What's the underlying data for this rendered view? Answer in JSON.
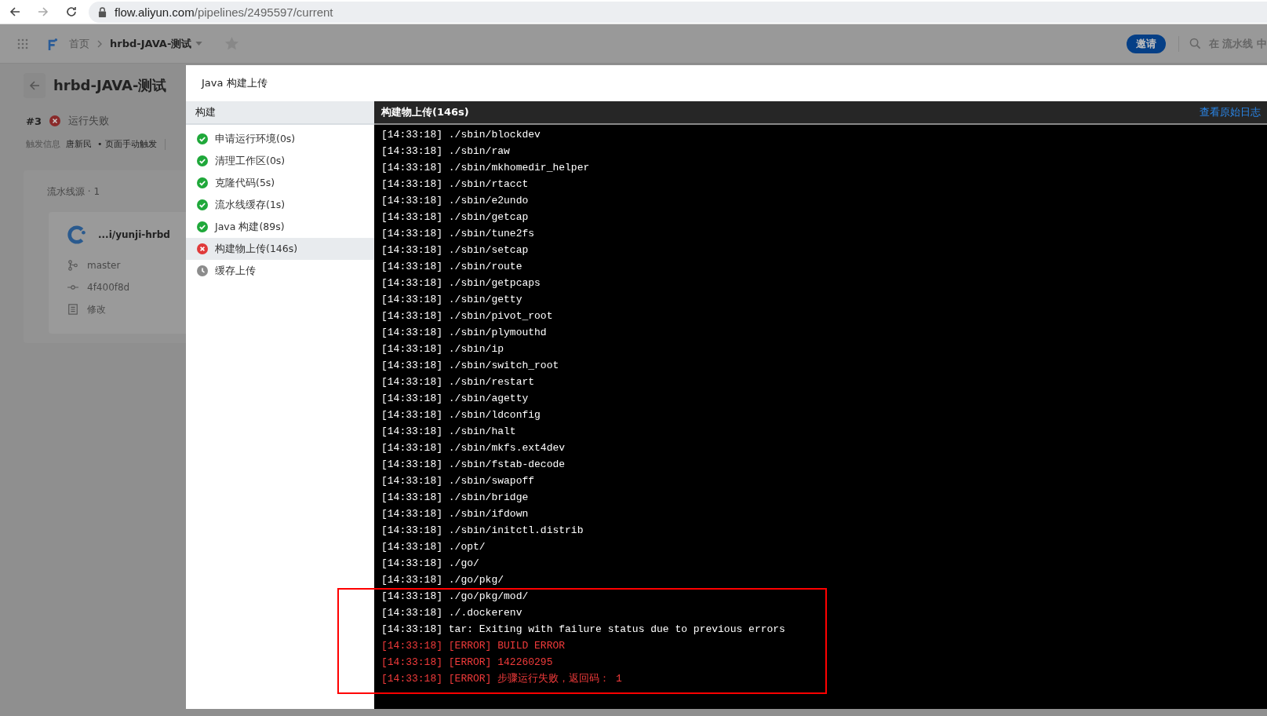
{
  "browser": {
    "url_host": "flow.aliyun.com",
    "url_path": "/pipelines/2495597/current"
  },
  "header": {
    "breadcrumb": [
      "首页",
      "hrbd-JAVA-测试"
    ],
    "invite_button": "邀请",
    "search_placeholder": "在 流水线 中"
  },
  "page": {
    "title": "hrbd-JAVA-测试",
    "run_number": "#3",
    "run_status": "运行失败",
    "trigger_label": "触发信息",
    "trigger_user": "唐新民",
    "trigger_mode": "• 页面手动触发",
    "sources_title": "流水线源 · 1",
    "source": {
      "repo": "...i/yunji-hrbd",
      "branch": "master",
      "commit": "4f400f8d",
      "message": "修改"
    }
  },
  "dialog": {
    "title": "Java 构建上传",
    "steps_header": "构建",
    "steps": [
      {
        "label": "申请运行环境(0s)",
        "kind": "success",
        "selected": false
      },
      {
        "label": "清理工作区(0s)",
        "kind": "success",
        "selected": false
      },
      {
        "label": "克隆代码(5s)",
        "kind": "success",
        "selected": false
      },
      {
        "label": "流水线缓存(1s)",
        "kind": "success",
        "selected": false
      },
      {
        "label": "Java 构建(89s)",
        "kind": "success",
        "selected": false
      },
      {
        "label": "构建物上传(146s)",
        "kind": "failed",
        "selected": true
      },
      {
        "label": "缓存上传",
        "kind": "pending",
        "selected": false
      }
    ],
    "log_title": "构建物上传(146s)",
    "raw_log_link": "查看原始日志",
    "log_lines": [
      {
        "text": "[14:33:18] ./sbin/blockdev",
        "kind": "info"
      },
      {
        "text": "[14:33:18] ./sbin/raw",
        "kind": "info"
      },
      {
        "text": "[14:33:18] ./sbin/mkhomedir_helper",
        "kind": "info"
      },
      {
        "text": "[14:33:18] ./sbin/rtacct",
        "kind": "info"
      },
      {
        "text": "[14:33:18] ./sbin/e2undo",
        "kind": "info"
      },
      {
        "text": "[14:33:18] ./sbin/getcap",
        "kind": "info"
      },
      {
        "text": "[14:33:18] ./sbin/tune2fs",
        "kind": "info"
      },
      {
        "text": "[14:33:18] ./sbin/setcap",
        "kind": "info"
      },
      {
        "text": "[14:33:18] ./sbin/route",
        "kind": "info"
      },
      {
        "text": "[14:33:18] ./sbin/getpcaps",
        "kind": "info"
      },
      {
        "text": "[14:33:18] ./sbin/getty",
        "kind": "info"
      },
      {
        "text": "[14:33:18] ./sbin/pivot_root",
        "kind": "info"
      },
      {
        "text": "[14:33:18] ./sbin/plymouthd",
        "kind": "info"
      },
      {
        "text": "[14:33:18] ./sbin/ip",
        "kind": "info"
      },
      {
        "text": "[14:33:18] ./sbin/switch_root",
        "kind": "info"
      },
      {
        "text": "[14:33:18] ./sbin/restart",
        "kind": "info"
      },
      {
        "text": "[14:33:18] ./sbin/agetty",
        "kind": "info"
      },
      {
        "text": "[14:33:18] ./sbin/ldconfig",
        "kind": "info"
      },
      {
        "text": "[14:33:18] ./sbin/halt",
        "kind": "info"
      },
      {
        "text": "[14:33:18] ./sbin/mkfs.ext4dev",
        "kind": "info"
      },
      {
        "text": "[14:33:18] ./sbin/fstab-decode",
        "kind": "info"
      },
      {
        "text": "[14:33:18] ./sbin/swapoff",
        "kind": "info"
      },
      {
        "text": "[14:33:18] ./sbin/bridge",
        "kind": "info"
      },
      {
        "text": "[14:33:18] ./sbin/ifdown",
        "kind": "info"
      },
      {
        "text": "[14:33:18] ./sbin/initctl.distrib",
        "kind": "info"
      },
      {
        "text": "[14:33:18] ./opt/",
        "kind": "info"
      },
      {
        "text": "[14:33:18] ./go/",
        "kind": "info"
      },
      {
        "text": "[14:33:18] ./go/pkg/",
        "kind": "info"
      },
      {
        "text": "[14:33:18] ./go/pkg/mod/",
        "kind": "info"
      },
      {
        "text": "[14:33:18] ./.dockerenv",
        "kind": "info"
      },
      {
        "text": "[14:33:18] tar: Exiting with failure status due to previous errors",
        "kind": "info"
      },
      {
        "text": "[14:33:18] [ERROR] BUILD ERROR",
        "kind": "error"
      },
      {
        "text": "[14:33:18] [ERROR] 142260295",
        "kind": "error"
      },
      {
        "text": "[14:33:18] [ERROR] 步骤运行失败，返回码： 1",
        "kind": "error"
      }
    ]
  }
}
